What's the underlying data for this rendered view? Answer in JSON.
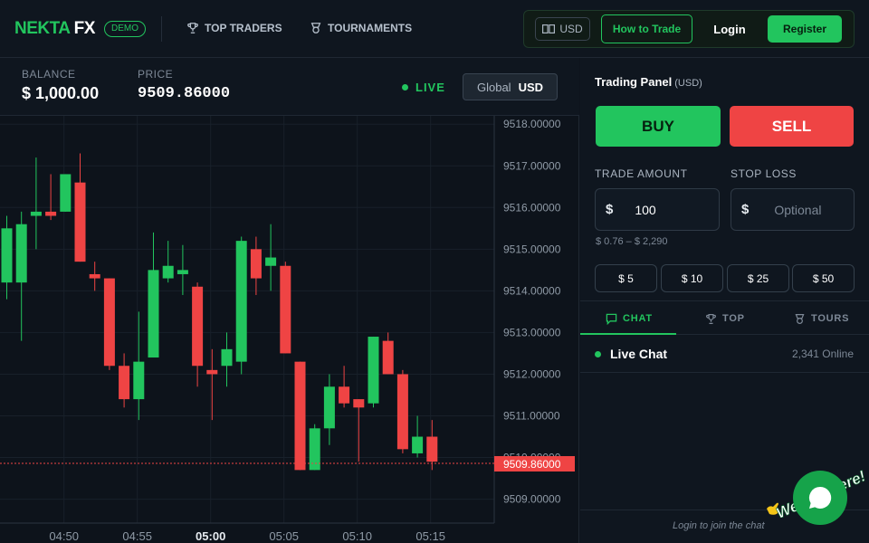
{
  "header": {
    "logo_part1": "NEKTA",
    "logo_part2": "FX",
    "badge": "DEMO",
    "nav": [
      {
        "label": "TOP TRADERS",
        "icon": "trophy-icon"
      },
      {
        "label": "TOURNAMENTS",
        "icon": "badge-icon"
      }
    ],
    "currency": "USD",
    "how_to_trade": "How to Trade",
    "login": "Login",
    "register": "Register"
  },
  "stats": {
    "balance_label": "BALANCE",
    "balance_value": "$ 1,000.00",
    "price_label": "PRICE",
    "price_value": "9509.86000",
    "live_label": "LIVE",
    "scope_label": "Global",
    "scope_currency": "USD"
  },
  "chart_data": {
    "type": "candlestick",
    "ylim": [
      9508.6,
      9518.2
    ],
    "y_ticks": [
      "9509.00000",
      "9510.00000",
      "9511.00000",
      "9512.00000",
      "9513.00000",
      "9514.00000",
      "9515.00000",
      "9516.00000",
      "9517.00000",
      "9518.00000"
    ],
    "y_tick_values": [
      9509,
      9510,
      9511,
      9512,
      9513,
      9514,
      9515,
      9516,
      9517,
      9518
    ],
    "x_ticks": [
      {
        "label": "04:50",
        "bold": false
      },
      {
        "label": "04:55",
        "bold": false
      },
      {
        "label": "05:00",
        "bold": true
      },
      {
        "label": "05:05",
        "bold": false
      },
      {
        "label": "05:10",
        "bold": false
      },
      {
        "label": "05:15",
        "bold": false
      }
    ],
    "current_price": 9509.86,
    "current_price_label": "9509.86000",
    "candles": [
      {
        "o": 9514.2,
        "c": 9515.5,
        "h": 9515.8,
        "l": 9513.8
      },
      {
        "o": 9514.2,
        "c": 9515.6,
        "h": 9515.9,
        "l": 9512.8
      },
      {
        "o": 9515.8,
        "c": 9515.9,
        "h": 9517.2,
        "l": 9515.0
      },
      {
        "o": 9515.9,
        "c": 9515.8,
        "h": 9516.8,
        "l": 9515.7
      },
      {
        "o": 9515.9,
        "c": 9516.8,
        "h": 9516.8,
        "l": 9515.9
      },
      {
        "o": 9516.6,
        "c": 9514.7,
        "h": 9517.3,
        "l": 9514.7
      },
      {
        "o": 9514.4,
        "c": 9514.3,
        "h": 9514.7,
        "l": 9514.0
      },
      {
        "o": 9514.3,
        "c": 9512.2,
        "h": 9514.3,
        "l": 9512.1
      },
      {
        "o": 9512.2,
        "c": 9511.4,
        "h": 9512.5,
        "l": 9511.2
      },
      {
        "o": 9511.4,
        "c": 9512.3,
        "h": 9513.5,
        "l": 9510.9
      },
      {
        "o": 9512.4,
        "c": 9514.5,
        "h": 9515.4,
        "l": 9512.4
      },
      {
        "o": 9514.3,
        "c": 9514.6,
        "h": 9515.2,
        "l": 9514.2
      },
      {
        "o": 9514.4,
        "c": 9514.5,
        "h": 9515.1,
        "l": 9513.9
      },
      {
        "o": 9514.1,
        "c": 9512.2,
        "h": 9514.2,
        "l": 9511.7
      },
      {
        "o": 9512.1,
        "c": 9512.0,
        "h": 9512.6,
        "l": 9510.9
      },
      {
        "o": 9512.2,
        "c": 9512.6,
        "h": 9513.0,
        "l": 9511.7
      },
      {
        "o": 9512.3,
        "c": 9515.2,
        "h": 9515.3,
        "l": 9512.0
      },
      {
        "o": 9515.0,
        "c": 9514.3,
        "h": 9515.3,
        "l": 9513.9
      },
      {
        "o": 9514.6,
        "c": 9514.8,
        "h": 9515.6,
        "l": 9514.0
      },
      {
        "o": 9514.6,
        "c": 9512.5,
        "h": 9514.7,
        "l": 9512.5
      },
      {
        "o": 9512.3,
        "c": 9509.7,
        "h": 9512.3,
        "l": 9509.7
      },
      {
        "o": 9509.7,
        "c": 9510.7,
        "h": 9510.8,
        "l": 9509.7
      },
      {
        "o": 9510.7,
        "c": 9511.7,
        "h": 9512.0,
        "l": 9510.3
      },
      {
        "o": 9511.7,
        "c": 9511.3,
        "h": 9512.2,
        "l": 9511.2
      },
      {
        "o": 9511.4,
        "c": 9511.2,
        "h": 9511.4,
        "l": 9509.9
      },
      {
        "o": 9511.3,
        "c": 9512.9,
        "h": 9512.9,
        "l": 9511.2
      },
      {
        "o": 9512.8,
        "c": 9512.0,
        "h": 9513.0,
        "l": 9512.0
      },
      {
        "o": 9512.0,
        "c": 9510.2,
        "h": 9512.1,
        "l": 9510.1
      },
      {
        "o": 9510.1,
        "c": 9510.5,
        "h": 9511.0,
        "l": 9510.0
      },
      {
        "o": 9510.5,
        "c": 9509.9,
        "h": 9510.9,
        "l": 9509.7
      }
    ]
  },
  "panel": {
    "title": "Trading Panel",
    "title_unit": "(USD)",
    "buy": "BUY",
    "sell": "SELL",
    "trade_amount_label": "TRADE AMOUNT",
    "trade_amount_currency": "$",
    "trade_amount_value": "100",
    "stop_loss_label": "STOP LOSS",
    "stop_loss_currency": "$",
    "stop_loss_placeholder": "Optional",
    "range": "$ 0.76 – $ 2,290",
    "quick_amounts": [
      "$ 5",
      "$ 10",
      "$ 25",
      "$ 50"
    ],
    "tabs": [
      "CHAT",
      "TOP",
      "TOURS"
    ],
    "chat_title": "Live Chat",
    "online": "2,341 Online",
    "chat_footer": "Login to join the chat",
    "widget_text": "We Are Here!"
  },
  "colors": {
    "green": "#22c55e",
    "red": "#ef4444",
    "bg": "#0d131b"
  }
}
